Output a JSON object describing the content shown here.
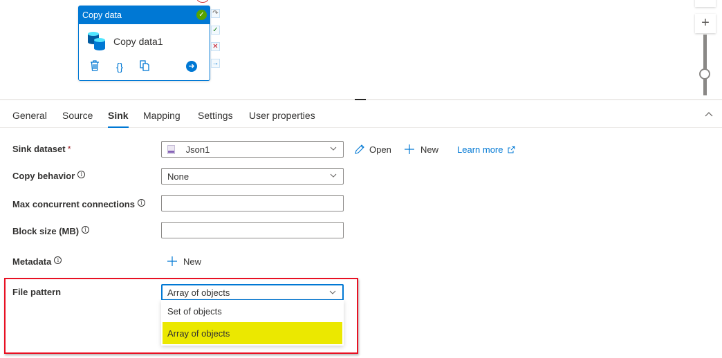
{
  "canvas": {
    "activity": {
      "type_label": "Copy data",
      "name": "Copy data1",
      "status": "succeeded",
      "actions": [
        "delete-icon",
        "code-icon",
        "clone-icon",
        "go-icon"
      ],
      "ports": [
        "skip",
        "success",
        "failure",
        "completion"
      ]
    },
    "zoom": {
      "plus": "+",
      "level": 0.4
    }
  },
  "tabs": [
    {
      "label": "General",
      "active": false
    },
    {
      "label": "Source",
      "active": false
    },
    {
      "label": "Sink",
      "active": true
    },
    {
      "label": "Mapping",
      "active": false
    },
    {
      "label": "Settings",
      "active": false
    },
    {
      "label": "User properties",
      "active": false
    }
  ],
  "form": {
    "sink_dataset": {
      "label": "Sink dataset",
      "required": "*",
      "value": "Json1",
      "open_label": "Open",
      "new_label": "New",
      "learn_more": "Learn more"
    },
    "copy_behavior": {
      "label": "Copy behavior",
      "value": "None"
    },
    "max_concurrent": {
      "label": "Max concurrent connections",
      "value": ""
    },
    "block_size": {
      "label": "Block size (MB)",
      "value": ""
    },
    "metadata": {
      "label": "Metadata",
      "new_label": "New"
    },
    "file_pattern": {
      "label": "File pattern",
      "value": "Array of objects",
      "options": [
        "Set of objects",
        "Array of objects"
      ],
      "selected_index": 1
    }
  },
  "colors": {
    "accent": "#0078d4",
    "highlight": "#ebe800",
    "annotation": "#e81123",
    "success": "#57a300"
  }
}
